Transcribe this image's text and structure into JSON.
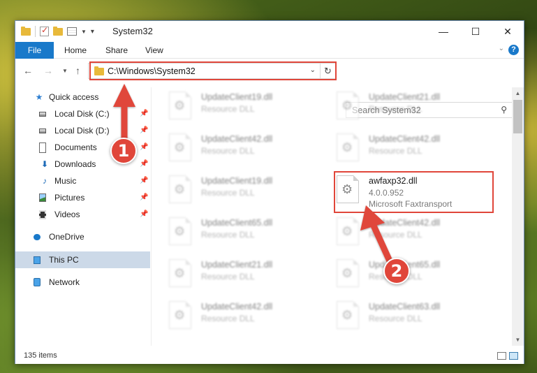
{
  "window": {
    "title": "System32",
    "controls": {
      "minimize": "—",
      "maximize": "☐",
      "close": "✕"
    }
  },
  "ribbon": {
    "tabs": [
      {
        "label": "File"
      },
      {
        "label": "Home"
      },
      {
        "label": "Share"
      },
      {
        "label": "View"
      }
    ],
    "help": "?"
  },
  "nav": {
    "address": "C:\\Windows\\System32",
    "search_placeholder": "Search System32"
  },
  "sidebar": {
    "items": [
      {
        "label": "Quick access",
        "icon": "star-icon"
      },
      {
        "label": "Local Disk (C:)",
        "icon": "drive-icon",
        "pinned": true
      },
      {
        "label": "Local Disk (D:)",
        "icon": "drive-icon",
        "pinned": true
      },
      {
        "label": "Documents",
        "icon": "documents-icon",
        "pinned": true
      },
      {
        "label": "Downloads",
        "icon": "downloads-icon",
        "pinned": true
      },
      {
        "label": "Music",
        "icon": "music-icon",
        "pinned": true
      },
      {
        "label": "Pictures",
        "icon": "pictures-icon",
        "pinned": true
      },
      {
        "label": "Videos",
        "icon": "videos-icon",
        "pinned": true
      },
      {
        "label": "OneDrive",
        "icon": "onedrive-icon"
      },
      {
        "label": "This PC",
        "icon": "this-pc-icon",
        "selected": true
      },
      {
        "label": "Network",
        "icon": "network-icon"
      }
    ]
  },
  "files": {
    "f0": {
      "name": "UpdateClient19.dll",
      "type": "Resource DLL"
    },
    "f1": {
      "name": "UpdateClient21.dll",
      "type": "Resource DLL"
    },
    "f2": {
      "name": "UpdateClient42.dll",
      "type": "Resource DLL"
    },
    "f3": {
      "name": "UpdateClient42.dll",
      "type": "Resource DLL"
    },
    "f4": {
      "name": "UpdateClient19.dll",
      "type": "Resource DLL"
    },
    "f5": {
      "name": "awfaxp32.dll",
      "version": "4.0.0.952",
      "company": "Microsoft Faxtransport"
    },
    "f6": {
      "name": "UpdateClient65.dll",
      "type": "Resource DLL"
    },
    "f7": {
      "name": "UpdateClient42.dll",
      "type": "Resource DLL"
    },
    "f8": {
      "name": "UpdateClient21.dll",
      "type": "Resource DLL"
    },
    "f9": {
      "name": "UpdateClient65.dll",
      "type": "Resource DLL"
    },
    "f10": {
      "name": "UpdateClient42.dll",
      "type": "Resource DLL"
    },
    "f11": {
      "name": "UpdateClient63.dll",
      "type": "Resource DLL"
    }
  },
  "status": {
    "item_count": "135 items"
  },
  "annotations": {
    "step1": "1",
    "step2": "2",
    "color": "#e0463a"
  }
}
